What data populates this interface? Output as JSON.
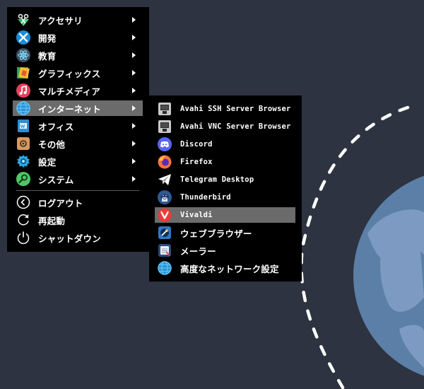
{
  "main_menu": {
    "items": [
      {
        "label": "アクセサリ",
        "icon": "accessories-icon",
        "has_submenu": true
      },
      {
        "label": "開発",
        "icon": "development-icon",
        "has_submenu": true
      },
      {
        "label": "教育",
        "icon": "education-icon",
        "has_submenu": true
      },
      {
        "label": "グラフィックス",
        "icon": "graphics-icon",
        "has_submenu": true
      },
      {
        "label": "マルチメディア",
        "icon": "multimedia-icon",
        "has_submenu": true
      },
      {
        "label": "インターネット",
        "icon": "internet-icon",
        "has_submenu": true,
        "highlighted": true
      },
      {
        "label": "オフィス",
        "icon": "office-icon",
        "has_submenu": true
      },
      {
        "label": "その他",
        "icon": "other-icon",
        "has_submenu": true
      },
      {
        "label": "設定",
        "icon": "settings-icon",
        "has_submenu": true
      },
      {
        "label": "システム",
        "icon": "system-icon",
        "has_submenu": true
      }
    ],
    "session_items": [
      {
        "label": "ログアウト",
        "icon": "logout-icon"
      },
      {
        "label": "再起動",
        "icon": "reboot-icon"
      },
      {
        "label": "シャットダウン",
        "icon": "shutdown-icon"
      }
    ]
  },
  "internet_submenu": {
    "items": [
      {
        "label": "Avahi SSH Server Browser",
        "icon": "network-server-icon"
      },
      {
        "label": "Avahi VNC Server Browser",
        "icon": "network-server-icon"
      },
      {
        "label": "Discord",
        "icon": "discord-icon"
      },
      {
        "label": "Firefox",
        "icon": "firefox-icon"
      },
      {
        "label": "Telegram Desktop",
        "icon": "telegram-icon"
      },
      {
        "label": "Thunderbird",
        "icon": "thunderbird-icon"
      },
      {
        "label": "Vivaldi",
        "icon": "vivaldi-icon",
        "highlighted": true
      },
      {
        "label": "ウェブブラウザー",
        "icon": "web-browser-icon"
      },
      {
        "label": "メーラー",
        "icon": "mail-client-icon"
      },
      {
        "label": "高度なネットワーク設定",
        "icon": "network-settings-icon"
      }
    ]
  },
  "colors": {
    "desktop_background": "#2d3340",
    "menu_background": "#000000",
    "highlight": "#6b6b6b",
    "text": "#ffffff",
    "globe": "#5c7fa8"
  }
}
